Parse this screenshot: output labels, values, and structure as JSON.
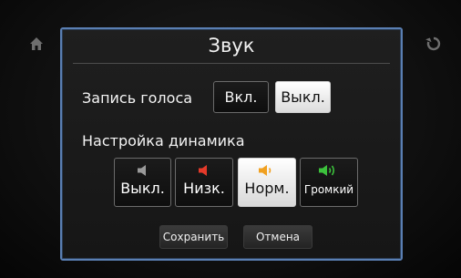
{
  "dialog": {
    "title": "Звук",
    "voice_recording": {
      "label": "Запись голоса",
      "options": [
        "Вкл.",
        "Выкл."
      ],
      "selected": "Выкл."
    },
    "speaker_settings": {
      "label": "Настройка динамика",
      "options": [
        {
          "label": "Выкл.",
          "icon": "speaker-mute-icon",
          "color": "#9a9a9a"
        },
        {
          "label": "Низк.",
          "icon": "speaker-low-icon",
          "color": "#e53a2a"
        },
        {
          "label": "Норм.",
          "icon": "speaker-normal-icon",
          "color": "#f0a020"
        },
        {
          "label": "Громкий",
          "icon": "speaker-loud-icon",
          "color": "#3cc23c"
        }
      ],
      "selected": "Норм."
    },
    "save_label": "Сохранить",
    "cancel_label": "Отмена"
  },
  "side_icons": {
    "left": "home-icon",
    "right": "back-icon"
  },
  "colors": {
    "accent_border": "#5a7fb3",
    "selected_button": "#ffffff"
  }
}
